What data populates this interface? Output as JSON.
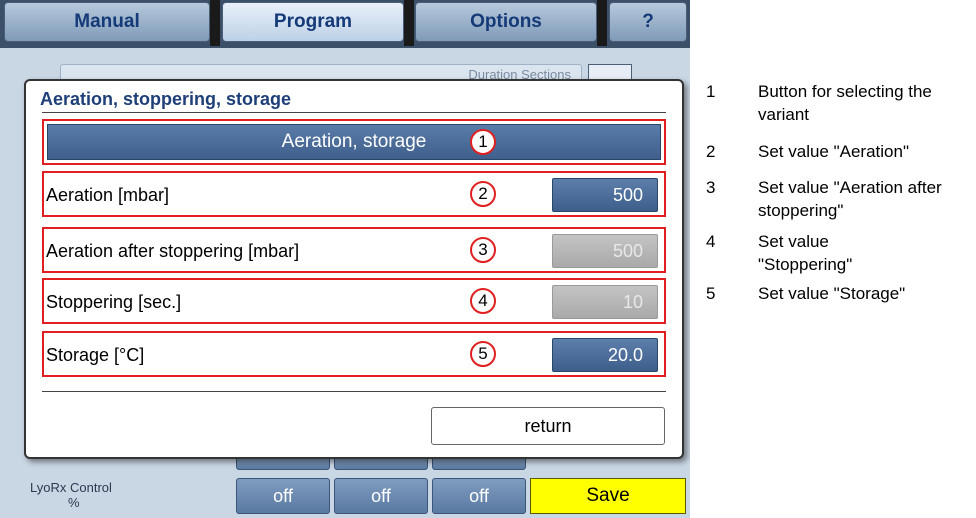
{
  "tabs": [
    {
      "label": "Manual",
      "active": false
    },
    {
      "label": "Program",
      "active": true
    },
    {
      "label": "Options",
      "active": false
    },
    {
      "label": "?",
      "active": false
    }
  ],
  "background": {
    "header_hint": "Duration   Sections",
    "footer_label": "LyoRx Control",
    "footer_unit": "%",
    "off_buttons": [
      "off",
      "off",
      "off"
    ],
    "save_label": "Save"
  },
  "dialog": {
    "title": "Aeration, stoppering, storage",
    "variant_button": "Aeration, storage",
    "rows": [
      {
        "label": "Aeration [mbar]",
        "value": "500",
        "state": "active"
      },
      {
        "label": "Aeration after stoppering [mbar]",
        "value": "500",
        "state": "disabled"
      },
      {
        "label": "Stoppering [sec.]",
        "value": "10",
        "state": "disabled"
      },
      {
        "label": "Storage [°C]",
        "value": "20.0",
        "state": "active"
      }
    ],
    "markers": [
      "1",
      "2",
      "3",
      "4",
      "5"
    ],
    "return_label": "return"
  },
  "legend": [
    {
      "num": "1",
      "text": "Button for selecting the variant"
    },
    {
      "num": "2",
      "text": "Set value \"Aeration\""
    },
    {
      "num": "3",
      "text": "Set value \"Aeration after stoppering\""
    },
    {
      "num": "4",
      "text": "Set value \"Stoppering\""
    },
    {
      "num": "5",
      "text": "Set value \"Storage\""
    }
  ],
  "colors": {
    "marker_red": "#e02020",
    "accent_blue": "#3f5f8c",
    "save_yellow": "#ffff00"
  }
}
